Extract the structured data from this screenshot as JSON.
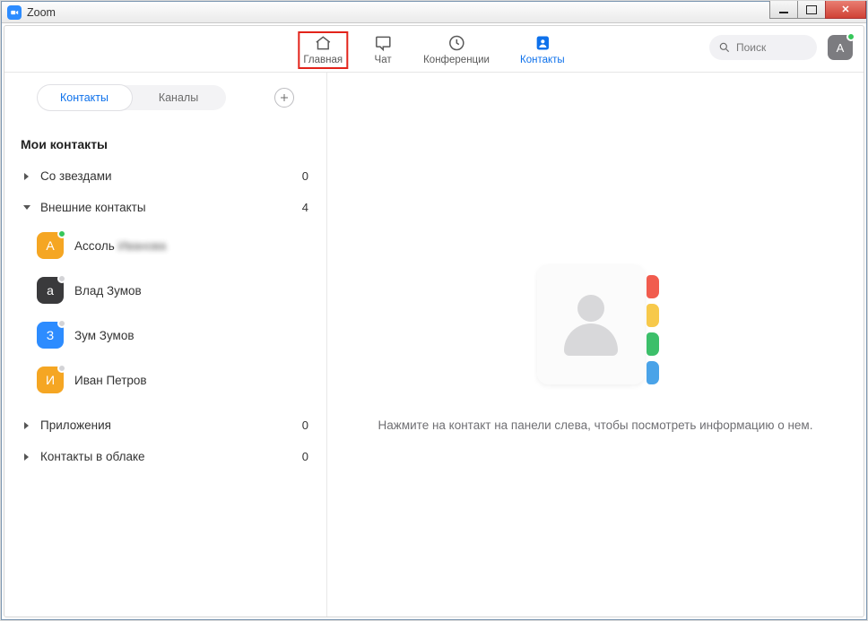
{
  "window": {
    "title": "Zoom"
  },
  "nav": {
    "home": "Главная",
    "chat": "Чат",
    "meetings": "Конференции",
    "contacts": "Контакты"
  },
  "search": {
    "placeholder_icon": "search",
    "placeholder": "Поиск"
  },
  "user_avatar": {
    "initial": "A",
    "status": "online"
  },
  "sidebar": {
    "segmented": {
      "contacts": "Контакты",
      "channels": "Каналы"
    },
    "section_title": "Мои контакты",
    "groups": {
      "starred": {
        "name": "Со звездами",
        "count": "0",
        "expanded": false
      },
      "external": {
        "name": "Внешние контакты",
        "count": "4",
        "expanded": true
      },
      "apps": {
        "name": "Приложения",
        "count": "0",
        "expanded": false
      },
      "cloud": {
        "name": "Контакты в облаке",
        "count": "0",
        "expanded": false
      }
    },
    "external_contacts": [
      {
        "initial": "A",
        "color": "orange",
        "status": "online",
        "name": "Ассоль",
        "extra_blurred": "Иванова"
      },
      {
        "initial": "a",
        "color": "dark",
        "status": "offline",
        "name": "Влад Зумов"
      },
      {
        "initial": "З",
        "color": "blue",
        "status": "offline",
        "name": "Зум Зумов"
      },
      {
        "initial": "И",
        "color": "orange",
        "status": "offline",
        "name": "Иван Петров"
      }
    ]
  },
  "main": {
    "empty_text": "Нажмите на контакт на панели слева, чтобы посмотреть информацию о нем."
  }
}
